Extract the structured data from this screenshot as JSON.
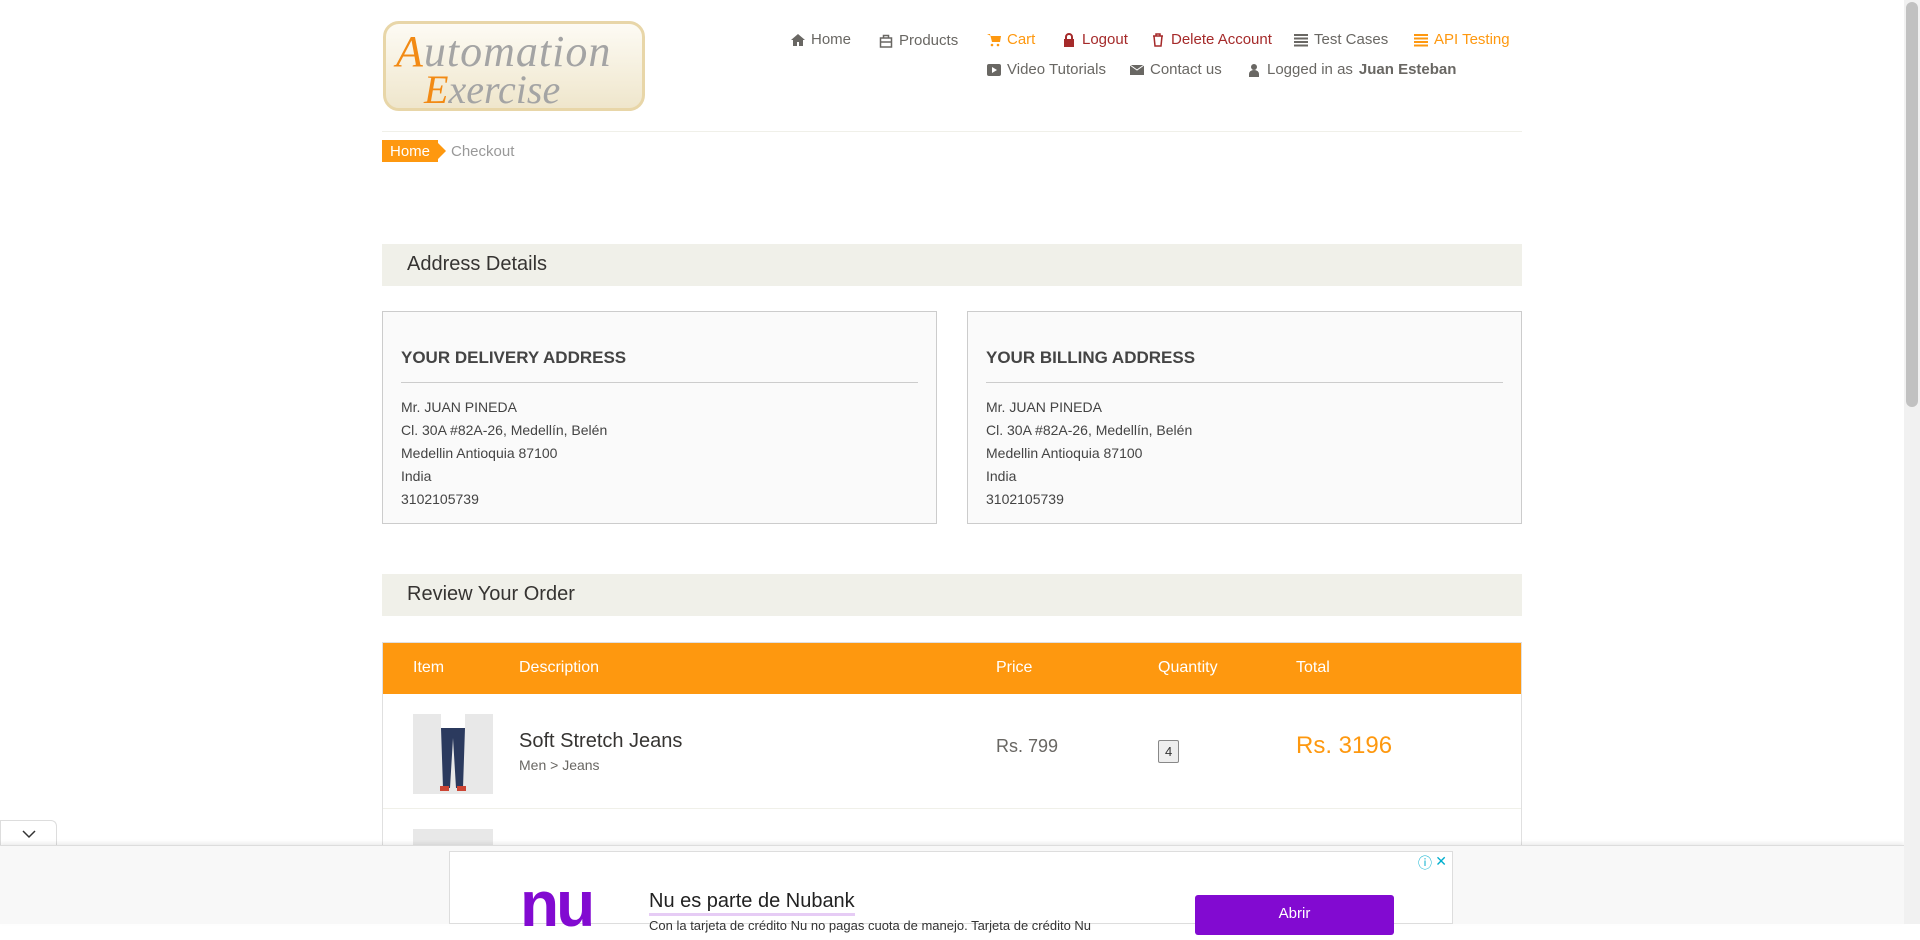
{
  "logo": {
    "text": "Automation Exercise"
  },
  "nav": {
    "row1": [
      "Home",
      "Products",
      "Cart",
      "Logout",
      "Delete Account",
      "Test Cases",
      "API Testing"
    ],
    "video": "Video Tutorials",
    "contact": "Contact us",
    "logged_prefix": "Logged in as",
    "user": "Juan Esteban"
  },
  "breadcrumb": {
    "home": "Home",
    "current": "Checkout"
  },
  "address": {
    "title": "Address Details",
    "delivery": {
      "heading": "YOUR DELIVERY ADDRESS",
      "lines": [
        "Mr. JUAN PINEDA",
        "Cl. 30A #82A-26, Medellín, Belén",
        "Medellin Antioquia 87100",
        "India",
        "3102105739"
      ]
    },
    "billing": {
      "heading": "YOUR BILLING ADDRESS",
      "lines": [
        "Mr. JUAN PINEDA",
        "Cl. 30A #82A-26, Medellín, Belén",
        "Medellin Antioquia 87100",
        "India",
        "3102105739"
      ]
    }
  },
  "review": {
    "title": "Review Your Order",
    "headers": [
      "Item",
      "Description",
      "Price",
      "Quantity",
      "Total"
    ],
    "items": [
      {
        "name": "Soft Stretch Jeans",
        "category": "Men > Jeans",
        "price": "Rs. 799",
        "quantity": "4",
        "total": "Rs. 3196"
      }
    ]
  },
  "ad": {
    "title": "Nu es parte de Nubank",
    "desc": "Con la tarjeta de crédito Nu no pagas cuota de manejo. Tarjeta de crédito Nu",
    "button": "Abrir",
    "logo": "nu"
  },
  "colors": {
    "accent": "#fe980f",
    "danger": "#a52a2a",
    "ad": "#820ad1"
  }
}
